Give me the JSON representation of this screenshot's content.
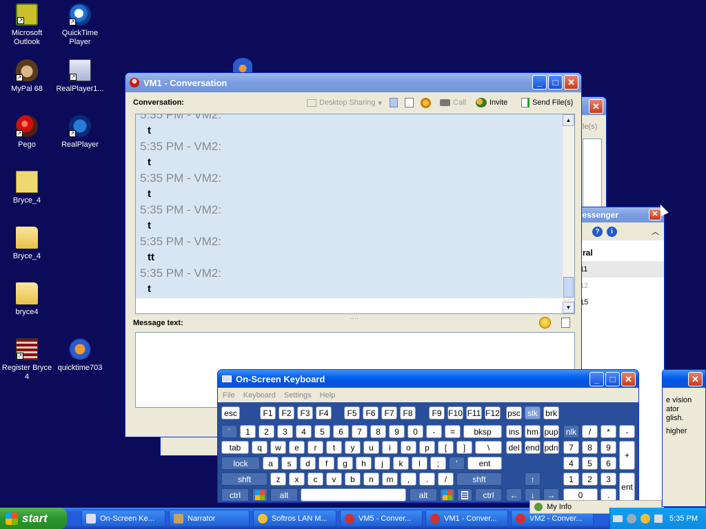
{
  "desktop": {
    "icons": [
      {
        "label": "Microsoft Outlook",
        "icon": "outlook-icon"
      },
      {
        "label": "QuickTime Player",
        "icon": "quicktime-icon"
      },
      {
        "label": "MyPal 68",
        "icon": "mypal-icon"
      },
      {
        "label": "RealPlayer1...",
        "icon": "realplayer-icon"
      },
      {
        "label": "Pego",
        "icon": "pego-icon"
      },
      {
        "label": "RealPlayer",
        "icon": "realplayer-icon"
      },
      {
        "label": "Bryce_4",
        "icon": "iso-icon"
      },
      {
        "label": "Bryce_4",
        "icon": "folder-icon"
      },
      {
        "label": "bryce4",
        "icon": "folder-icon"
      },
      {
        "label": "Register Bryce 4",
        "icon": "register-icon"
      },
      {
        "label": "quicktime703",
        "icon": "installer-icon"
      }
    ]
  },
  "back_window": {
    "label_fragment": "le(s)"
  },
  "messenger": {
    "title_fragment": "lessenger",
    "section": "ral",
    "items": [
      "11",
      "12",
      "15"
    ]
  },
  "narrator_window": {
    "lines": [
      "e vision",
      "ator",
      "glish.",
      "higher"
    ]
  },
  "conversation": {
    "title": "VM1 - Conversation",
    "conversation_label": "Conversation:",
    "toolbar": {
      "desktop_sharing": "Desktop Sharing",
      "call": "Call",
      "invite": "Invite",
      "send_files": "Send File(s)"
    },
    "partial_top": "5:35 PM - VM2:",
    "messages": [
      {
        "time": "5:35 PM - VM2:",
        "text": "t"
      },
      {
        "time": "5:35 PM - VM2:",
        "text": "t"
      },
      {
        "time": "5:35 PM - VM2:",
        "text": "t"
      },
      {
        "time": "5:35 PM - VM2:",
        "text": "tt"
      },
      {
        "time": "5:35 PM - VM2:",
        "text": "t"
      }
    ],
    "first_text": "t",
    "message_label": "Message text:",
    "message_value": ""
  },
  "keyboard": {
    "title": "On-Screen Keyboard",
    "menu": [
      "File",
      "Keyboard",
      "Settings",
      "Help"
    ],
    "keys": {
      "esc": "esc",
      "f1": "F1",
      "f2": "F2",
      "f3": "F3",
      "f4": "F4",
      "f5": "F5",
      "f6": "F6",
      "f7": "F7",
      "f8": "F8",
      "f9": "F9",
      "f10": "F10",
      "f11": "F11",
      "f12": "F12",
      "psc": "psc",
      "slk": "slk",
      "brk": "brk",
      "backtick": "`",
      "n1": "1",
      "n2": "2",
      "n3": "3",
      "n4": "4",
      "n5": "5",
      "n6": "6",
      "n7": "7",
      "n8": "8",
      "n9": "9",
      "n0": "0",
      "minus": "-",
      "equal": "=",
      "bksp": "bksp",
      "ins": "ins",
      "hm": "hm",
      "pup": "pup",
      "nlk": "nlk",
      "np_div": "/",
      "np_mul": "*",
      "np_sub": "-",
      "tab": "tab",
      "q": "q",
      "w": "w",
      "e": "e",
      "r": "r",
      "t": "t",
      "y": "y",
      "u": "u",
      "i": "i",
      "o": "o",
      "p": "p",
      "lbr": "[",
      "rbr": "]",
      "bslash": "\\",
      "del": "del",
      "end": "end",
      "pdn": "pdn",
      "np7": "7",
      "np8": "8",
      "np9": "9",
      "lock": "lock",
      "a": "a",
      "s": "s",
      "d": "d",
      "f": "f",
      "g": "g",
      "h": "h",
      "j": "j",
      "k": "k",
      "l": "l",
      "semi": ";",
      "quote": "'",
      "ent": "ent",
      "np4": "4",
      "np5": "5",
      "np6": "6",
      "np_add": "+",
      "shft": "shft",
      "z": "z",
      "x": "x",
      "c": "c",
      "v": "v",
      "b": "b",
      "n": "n",
      "m": "m",
      "comma": ",",
      "period": ".",
      "slash": "/",
      "shft_r": "shft",
      "up": "↑",
      "np1": "1",
      "np2": "2",
      "np3": "3",
      "ctrl": "ctrl",
      "alt": "alt",
      "alt_r": "alt",
      "ctrl_r": "ctrl",
      "left": "←",
      "down": "↓",
      "right": "→",
      "np0": "0",
      "np_dot": ".",
      "np_ent": "ent"
    }
  },
  "taskbar": {
    "start": "start",
    "items": [
      "On-Screen Ke...",
      "Narrator",
      "Softros LAN M...",
      "VM5 - Conver...",
      "VM1 - Conver...",
      "VM2 - Conver..."
    ],
    "my_info": "My Info",
    "clock": "5:35 PM"
  }
}
